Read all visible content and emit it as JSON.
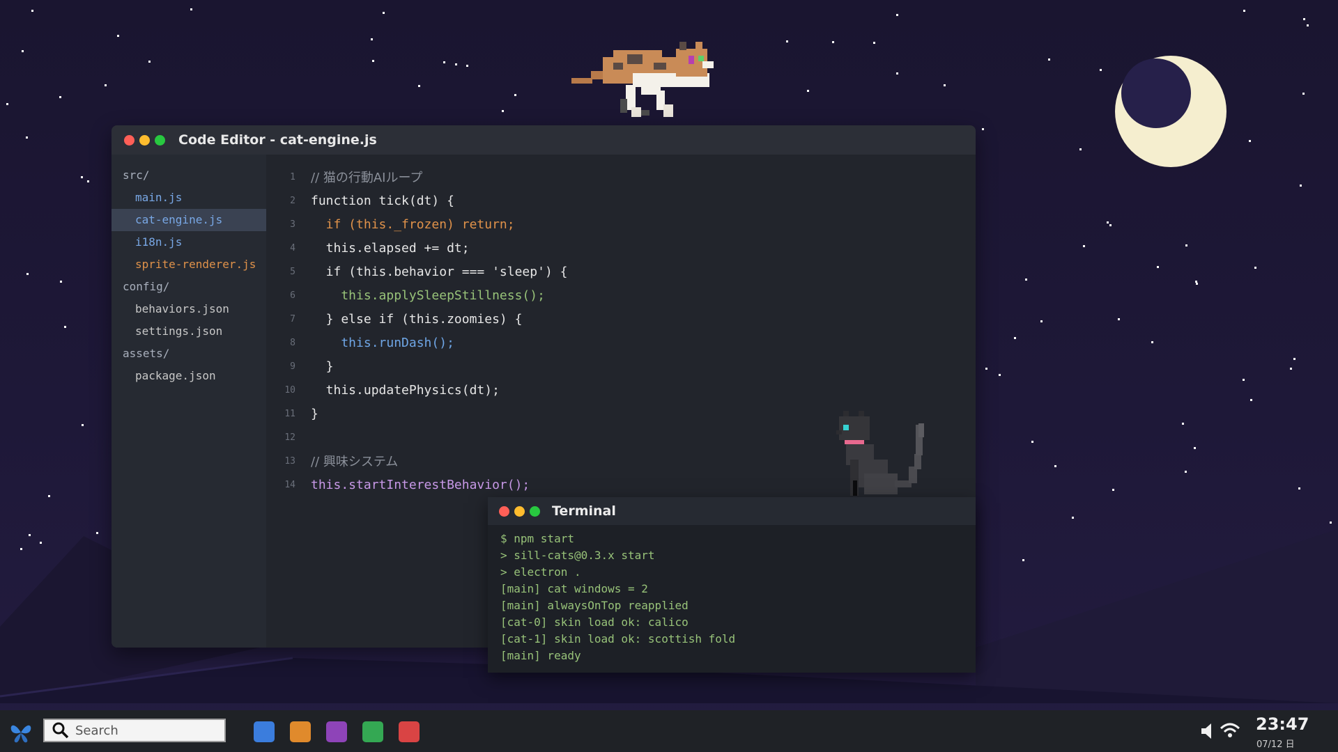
{
  "editor": {
    "title": "Code Editor - cat-engine.js",
    "files": [
      {
        "label": "src/",
        "kind": "folder",
        "color": "default"
      },
      {
        "label": "main.js",
        "kind": "file",
        "color": "blue"
      },
      {
        "label": "cat-engine.js",
        "kind": "file",
        "color": "blue",
        "active": true
      },
      {
        "label": "i18n.js",
        "kind": "file",
        "color": "blue"
      },
      {
        "label": "sprite-renderer.js",
        "kind": "file",
        "color": "orange"
      },
      {
        "label": "config/",
        "kind": "folder",
        "color": "default"
      },
      {
        "label": "behaviors.json",
        "kind": "file",
        "color": "default"
      },
      {
        "label": "settings.json",
        "kind": "file",
        "color": "default"
      },
      {
        "label": "assets/",
        "kind": "folder",
        "color": "default"
      },
      {
        "label": "package.json",
        "kind": "file",
        "color": "default"
      }
    ],
    "code_lines": [
      {
        "n": "1",
        "text": "// 猫の行動AIループ",
        "style": "comment"
      },
      {
        "n": "2",
        "text": "function tick(dt) {",
        "style": "plain"
      },
      {
        "n": "3",
        "text": "  if (this._frozen) return;",
        "style": "orange"
      },
      {
        "n": "4",
        "text": "  this.elapsed += dt;",
        "style": "plain"
      },
      {
        "n": "5",
        "text": "  if (this.behavior === 'sleep') {",
        "style": "plain"
      },
      {
        "n": "6",
        "text": "    this.applySleepStillness();",
        "style": "green"
      },
      {
        "n": "7",
        "text": "  } else if (this.zoomies) {",
        "style": "plain"
      },
      {
        "n": "8",
        "text": "    this.runDash();",
        "style": "blue"
      },
      {
        "n": "9",
        "text": "  }",
        "style": "plain"
      },
      {
        "n": "10",
        "text": "  this.updatePhysics(dt);",
        "style": "plain"
      },
      {
        "n": "11",
        "text": "}",
        "style": "plain"
      },
      {
        "n": "12",
        "text": "",
        "style": "plain"
      },
      {
        "n": "13",
        "text": "// 興味システム",
        "style": "comment"
      },
      {
        "n": "14",
        "text": "this.startInterestBehavior();",
        "style": "purple"
      }
    ]
  },
  "terminal": {
    "title": "Terminal",
    "lines": [
      "$ npm start",
      "> sill-cats@0.3.x start",
      "> electron .",
      "[main] cat windows = 2",
      "[main] alwaysOnTop reapplied",
      "[cat-0] skin load ok: calico",
      "[cat-1] skin load ok: scottish fold",
      "[main] ready"
    ]
  },
  "taskbar": {
    "search_placeholder": "Search",
    "apps": [
      {
        "icon": "blue-app-icon",
        "color": "#3b7ddd"
      },
      {
        "icon": "orange-app-icon",
        "color": "#e08a2c"
      },
      {
        "icon": "purple-app-icon",
        "color": "#8e44b8"
      },
      {
        "icon": "green-app-icon",
        "color": "#34a853"
      },
      {
        "icon": "red-app-icon",
        "color": "#d94444"
      }
    ],
    "clock": "23:47",
    "date": "07/12 日"
  }
}
